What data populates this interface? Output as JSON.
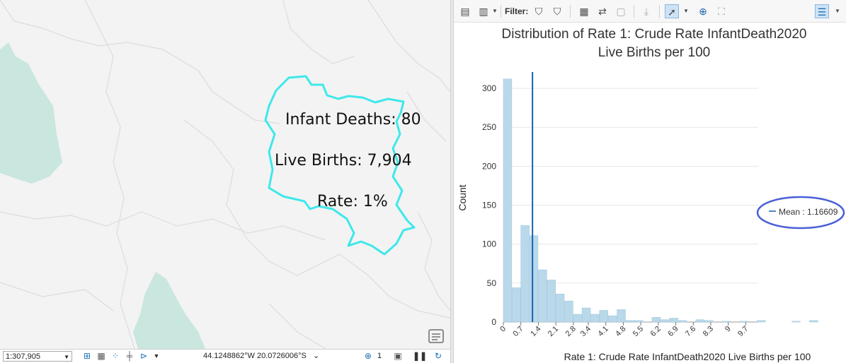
{
  "map": {
    "labels": {
      "infant_deaths": "Infant Deaths: 80",
      "live_births": "Live Births: 7,904",
      "rate": "Rate: 1%"
    },
    "status_bar": {
      "scale": "1:307,905",
      "coordinates": "44.1248862°W 20.0726006°S",
      "selected_count": "1"
    },
    "colors": {
      "background": "#f3f3f3",
      "water": "#c9e6df",
      "boundary": "#dcdcdc",
      "highlight": "#3ee8ea"
    }
  },
  "chart_panel": {
    "toolbar": {
      "filter_label": "Filter:"
    },
    "legend": {
      "mean_label": "Mean : 1.16609"
    },
    "annotation_color": "#4a5fd6"
  },
  "chart_data": {
    "type": "bar",
    "title": [
      "Distribution of Rate 1: Crude Rate InfantDeath2020",
      "Live Births per 100"
    ],
    "xlabel": "Rate 1: Crude Rate InfantDeath2020 Live Births per 100",
    "ylabel": "Count",
    "x_tick_labels": [
      "0",
      "0.7",
      "1.4",
      "2.1",
      "2.8",
      "3.4",
      "4.1",
      "4.8",
      "5.5",
      "6.2",
      "6.9",
      "7.6",
      "8.3",
      "9",
      "9.7"
    ],
    "y_ticks": [
      0,
      50,
      100,
      150,
      200,
      250,
      300
    ],
    "ylim": [
      0,
      330
    ],
    "bin_start": 0,
    "bin_width": 0.35,
    "counts": [
      312,
      44,
      124,
      111,
      67,
      54,
      36,
      27,
      10,
      18,
      10,
      15,
      8,
      16,
      2,
      2,
      0,
      6,
      3,
      5,
      2,
      0,
      3,
      2,
      0,
      1,
      0,
      1,
      0,
      2,
      0,
      0,
      0,
      1,
      0,
      2
    ],
    "mean": 1.16609,
    "bar_color": "#b9d9ea",
    "mean_line_color": "#1560b0",
    "grid": true
  }
}
